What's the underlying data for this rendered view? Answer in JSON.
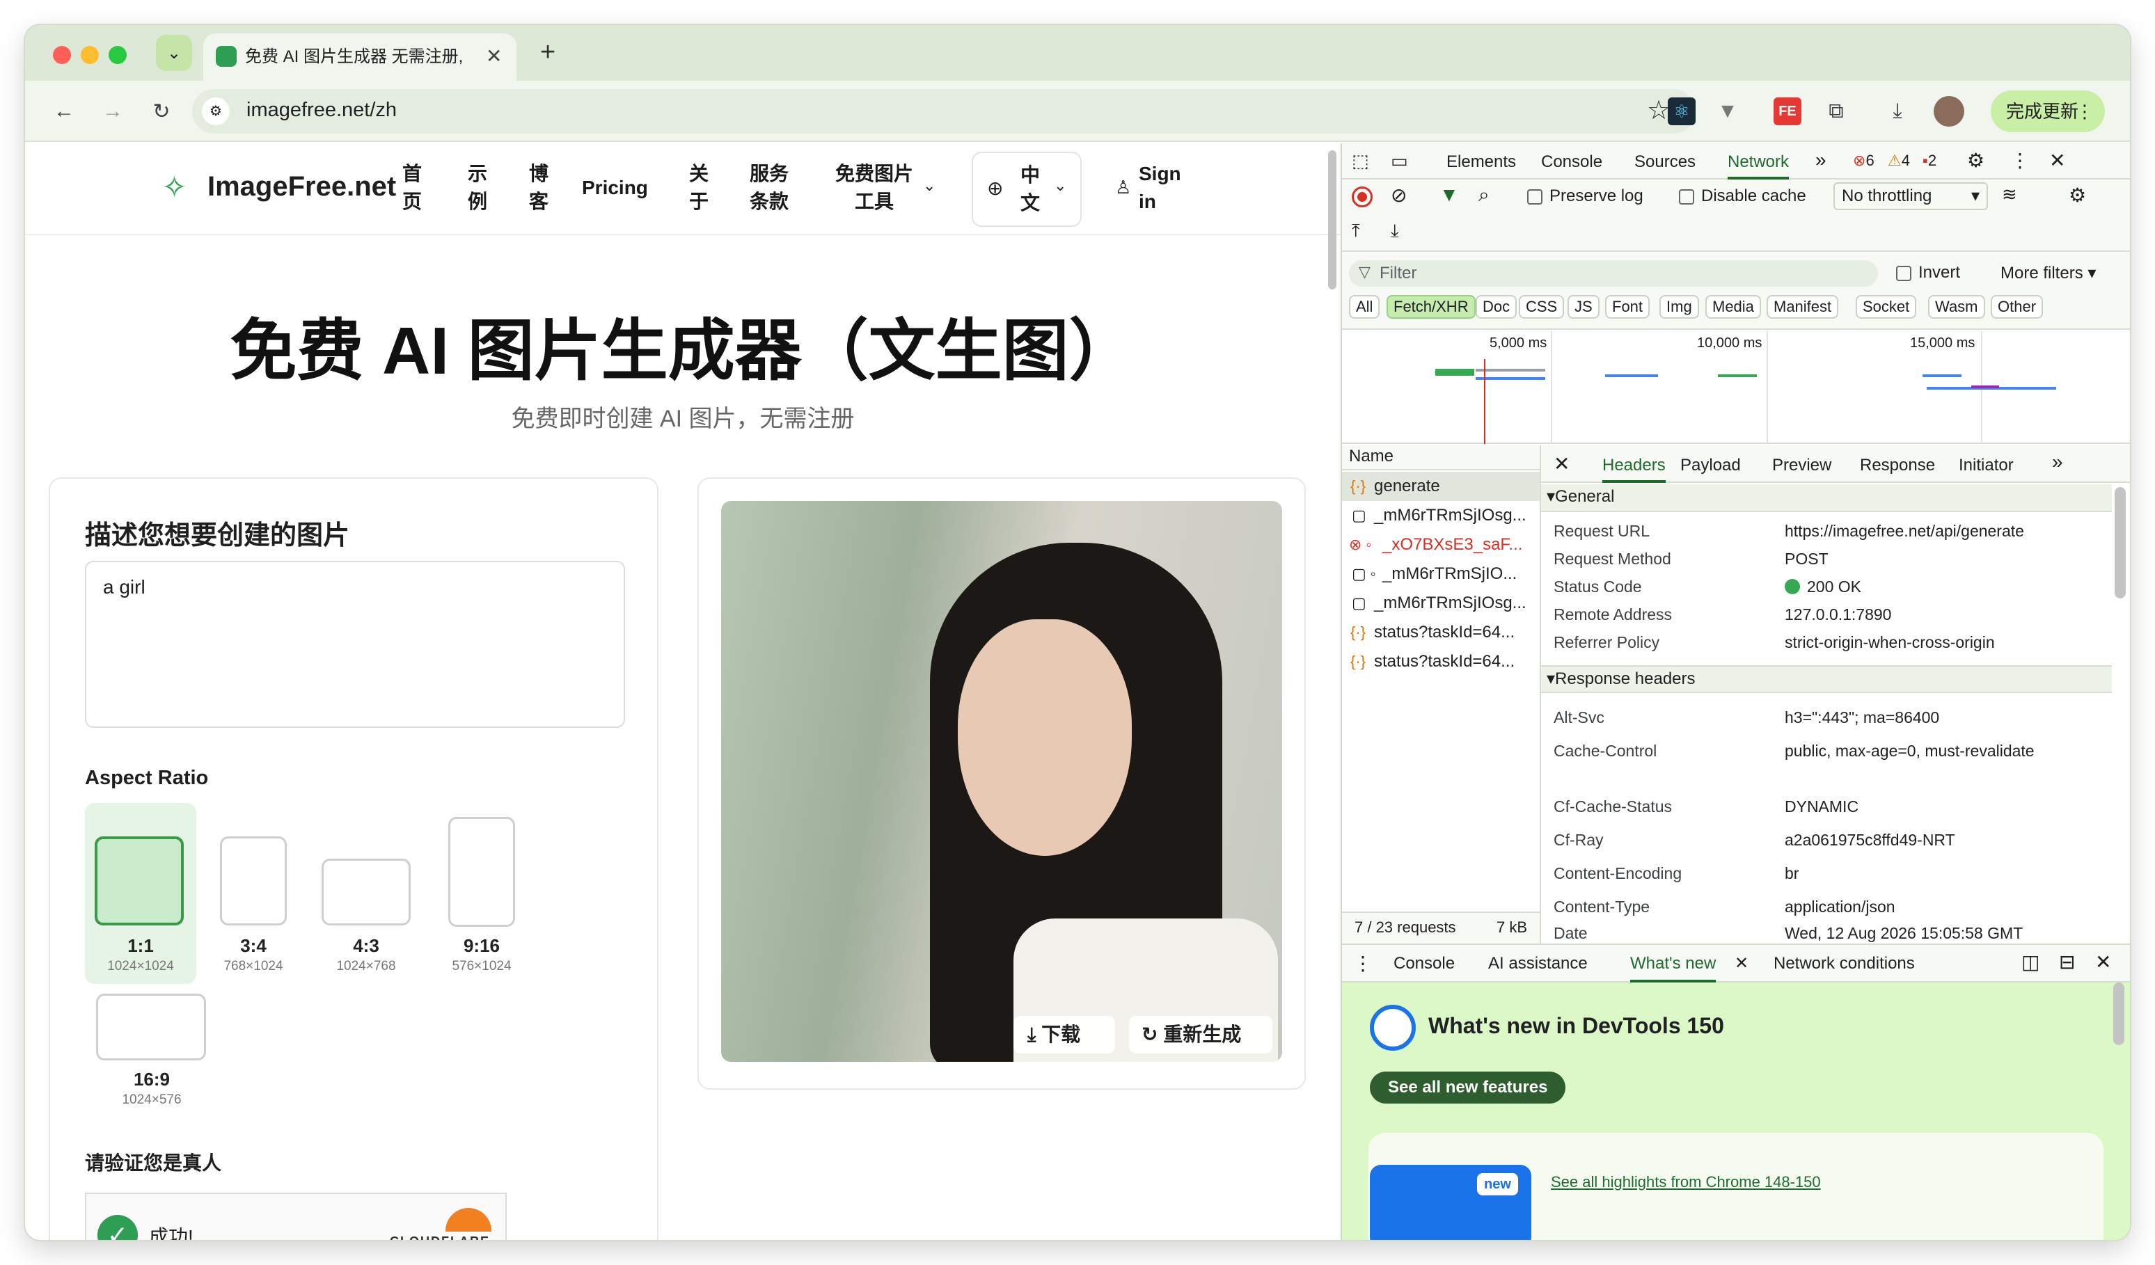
{
  "browser": {
    "tab_title": "免费 AI 图片生成器 无需注册,",
    "new_tab": "+",
    "url": "imagefree.net/zh",
    "update_label": "完成更新"
  },
  "site": {
    "logo": "ImageFree.net",
    "nav": [
      {
        "id": "home",
        "label": "首\n页"
      },
      {
        "id": "examples",
        "label": "示\n例"
      },
      {
        "id": "blog",
        "label": "博\n客"
      },
      {
        "id": "pricing",
        "label": "Pricing"
      },
      {
        "id": "about",
        "label": "关\n于"
      },
      {
        "id": "terms",
        "label": "服务\n条款"
      },
      {
        "id": "tools",
        "label": "免费图片\n工具"
      }
    ],
    "lang": "中\n文",
    "signin": "Sign\nin",
    "hero_title": "免费 AI 图片生成器（文生图）",
    "hero_subtitle": "免费即时创建 AI 图片，无需注册",
    "prompt_heading": "描述您想要创建的图片",
    "prompt_value": "a girl",
    "aspect_heading": "Aspect Ratio",
    "ratios": [
      {
        "label": "1:1",
        "size": "1024×1024",
        "selected": true
      },
      {
        "label": "3:4",
        "size": "768×1024",
        "selected": false
      },
      {
        "label": "4:3",
        "size": "1024×768",
        "selected": false
      },
      {
        "label": "9:16",
        "size": "576×1024",
        "selected": false
      },
      {
        "label": "16:9",
        "size": "1024×576",
        "selected": false
      }
    ],
    "verify_heading": "请验证您是真人",
    "captcha_success": "成功!",
    "captcha_brand": "CLOUDFLARE",
    "download_label": "下载",
    "regenerate_label": "重新生成"
  },
  "devtools": {
    "tabs": [
      "Elements",
      "Console",
      "Sources",
      "Network"
    ],
    "active_tab": "Network",
    "errors": "6",
    "warnings": "4",
    "issues": "2",
    "preserve_log": "Preserve log",
    "disable_cache": "Disable cache",
    "throttling": "No throttling",
    "filter_placeholder": "Filter",
    "invert": "Invert",
    "more_filters": "More filters",
    "type_filters": [
      "All",
      "Fetch/XHR",
      "Doc",
      "CSS",
      "JS",
      "Font",
      "Img",
      "Media",
      "Manifest",
      "Socket",
      "Wasm",
      "Other"
    ],
    "active_filter": "Fetch/XHR",
    "timeline_ticks": [
      "5,000 ms",
      "10,000 ms",
      "15,000 ms"
    ],
    "name_header": "Name",
    "requests": [
      {
        "name": "generate",
        "type": "fetch",
        "error": false,
        "selected": true
      },
      {
        "name": "_mM6rTRmSjIOsg...",
        "type": "doc",
        "error": false,
        "selected": false
      },
      {
        "name": "_xO7BXsE3_saF...",
        "type": "doc",
        "error": true,
        "selected": false
      },
      {
        "name": "_mM6rTRmSjIO...",
        "type": "doc",
        "error": false,
        "selected": false
      },
      {
        "name": "_mM6rTRmSjIOsg...",
        "type": "doc",
        "error": false,
        "selected": false
      },
      {
        "name": "status?taskId=64...",
        "type": "fetch",
        "error": false,
        "selected": false
      },
      {
        "name": "status?taskId=64...",
        "type": "fetch",
        "error": false,
        "selected": false
      }
    ],
    "summary_requests": "7 / 23 requests",
    "summary_size": "7 kB",
    "detail_tabs": [
      "Headers",
      "Payload",
      "Preview",
      "Response",
      "Initiator"
    ],
    "active_detail_tab": "Headers",
    "general_title": "General",
    "general": [
      {
        "k": "Request URL",
        "v": "https://imagefree.net/api/generate"
      },
      {
        "k": "Request Method",
        "v": "POST"
      },
      {
        "k": "Status Code",
        "v": "200 OK"
      },
      {
        "k": "Remote Address",
        "v": "127.0.0.1:7890"
      },
      {
        "k": "Referrer Policy",
        "v": "strict-origin-when-cross-origin"
      }
    ],
    "response_title": "Response headers",
    "response": [
      {
        "k": "Alt-Svc",
        "v": "h3=\":443\"; ma=86400"
      },
      {
        "k": "Cache-Control",
        "v": "public, max-age=0, must-revalidate"
      },
      {
        "k": "Cf-Cache-Status",
        "v": "DYNAMIC"
      },
      {
        "k": "Cf-Ray",
        "v": "a2a061975c8ffd49-NRT"
      },
      {
        "k": "Content-Encoding",
        "v": "br"
      },
      {
        "k": "Content-Type",
        "v": "application/json"
      },
      {
        "k": "Date",
        "v": "Wed, 12 Aug 2026 15:05:58 GMT"
      }
    ],
    "drawer_tabs": [
      "Console",
      "AI assistance",
      "What's new",
      "Network conditions"
    ],
    "active_drawer_tab": "What's new",
    "whatsnew_title": "What's new in DevTools 150",
    "whatsnew_button": "See all new features",
    "new_badge": "new",
    "highlights_link": "See all highlights from Chrome 148-150"
  },
  "colors": {
    "accent_green": "#4caf50",
    "devtools_active": "#1e6b2e",
    "error_red": "#d93025",
    "whatsnew_bg": "#dcf8c6",
    "tab_bg": "#dde8d6"
  }
}
